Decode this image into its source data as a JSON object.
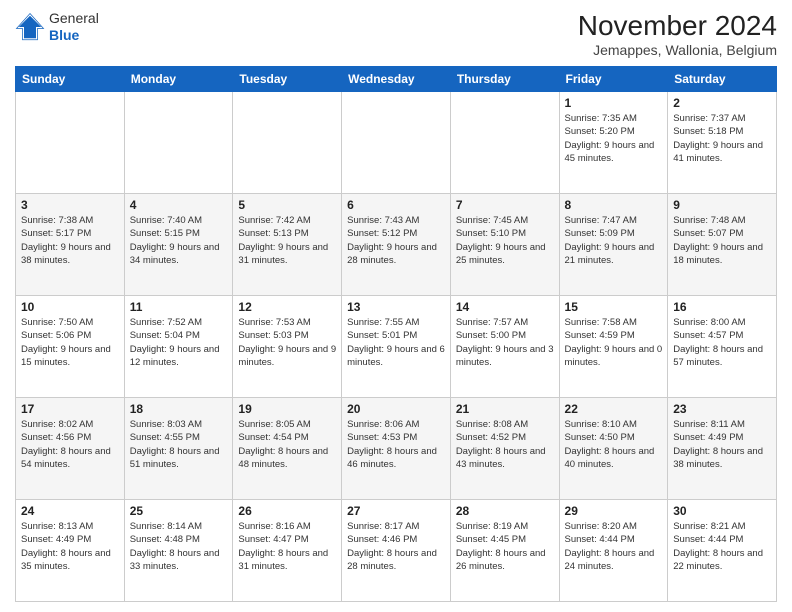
{
  "logo": {
    "general": "General",
    "blue": "Blue"
  },
  "header": {
    "title": "November 2024",
    "subtitle": "Jemappes, Wallonia, Belgium"
  },
  "weekdays": [
    "Sunday",
    "Monday",
    "Tuesday",
    "Wednesday",
    "Thursday",
    "Friday",
    "Saturday"
  ],
  "weeks": [
    [
      {
        "day": "",
        "info": ""
      },
      {
        "day": "",
        "info": ""
      },
      {
        "day": "",
        "info": ""
      },
      {
        "day": "",
        "info": ""
      },
      {
        "day": "",
        "info": ""
      },
      {
        "day": "1",
        "sunrise": "Sunrise: 7:35 AM",
        "sunset": "Sunset: 5:20 PM",
        "daylight": "Daylight: 9 hours and 45 minutes."
      },
      {
        "day": "2",
        "sunrise": "Sunrise: 7:37 AM",
        "sunset": "Sunset: 5:18 PM",
        "daylight": "Daylight: 9 hours and 41 minutes."
      }
    ],
    [
      {
        "day": "3",
        "sunrise": "Sunrise: 7:38 AM",
        "sunset": "Sunset: 5:17 PM",
        "daylight": "Daylight: 9 hours and 38 minutes."
      },
      {
        "day": "4",
        "sunrise": "Sunrise: 7:40 AM",
        "sunset": "Sunset: 5:15 PM",
        "daylight": "Daylight: 9 hours and 34 minutes."
      },
      {
        "day": "5",
        "sunrise": "Sunrise: 7:42 AM",
        "sunset": "Sunset: 5:13 PM",
        "daylight": "Daylight: 9 hours and 31 minutes."
      },
      {
        "day": "6",
        "sunrise": "Sunrise: 7:43 AM",
        "sunset": "Sunset: 5:12 PM",
        "daylight": "Daylight: 9 hours and 28 minutes."
      },
      {
        "day": "7",
        "sunrise": "Sunrise: 7:45 AM",
        "sunset": "Sunset: 5:10 PM",
        "daylight": "Daylight: 9 hours and 25 minutes."
      },
      {
        "day": "8",
        "sunrise": "Sunrise: 7:47 AM",
        "sunset": "Sunset: 5:09 PM",
        "daylight": "Daylight: 9 hours and 21 minutes."
      },
      {
        "day": "9",
        "sunrise": "Sunrise: 7:48 AM",
        "sunset": "Sunset: 5:07 PM",
        "daylight": "Daylight: 9 hours and 18 minutes."
      }
    ],
    [
      {
        "day": "10",
        "sunrise": "Sunrise: 7:50 AM",
        "sunset": "Sunset: 5:06 PM",
        "daylight": "Daylight: 9 hours and 15 minutes."
      },
      {
        "day": "11",
        "sunrise": "Sunrise: 7:52 AM",
        "sunset": "Sunset: 5:04 PM",
        "daylight": "Daylight: 9 hours and 12 minutes."
      },
      {
        "day": "12",
        "sunrise": "Sunrise: 7:53 AM",
        "sunset": "Sunset: 5:03 PM",
        "daylight": "Daylight: 9 hours and 9 minutes."
      },
      {
        "day": "13",
        "sunrise": "Sunrise: 7:55 AM",
        "sunset": "Sunset: 5:01 PM",
        "daylight": "Daylight: 9 hours and 6 minutes."
      },
      {
        "day": "14",
        "sunrise": "Sunrise: 7:57 AM",
        "sunset": "Sunset: 5:00 PM",
        "daylight": "Daylight: 9 hours and 3 minutes."
      },
      {
        "day": "15",
        "sunrise": "Sunrise: 7:58 AM",
        "sunset": "Sunset: 4:59 PM",
        "daylight": "Daylight: 9 hours and 0 minutes."
      },
      {
        "day": "16",
        "sunrise": "Sunrise: 8:00 AM",
        "sunset": "Sunset: 4:57 PM",
        "daylight": "Daylight: 8 hours and 57 minutes."
      }
    ],
    [
      {
        "day": "17",
        "sunrise": "Sunrise: 8:02 AM",
        "sunset": "Sunset: 4:56 PM",
        "daylight": "Daylight: 8 hours and 54 minutes."
      },
      {
        "day": "18",
        "sunrise": "Sunrise: 8:03 AM",
        "sunset": "Sunset: 4:55 PM",
        "daylight": "Daylight: 8 hours and 51 minutes."
      },
      {
        "day": "19",
        "sunrise": "Sunrise: 8:05 AM",
        "sunset": "Sunset: 4:54 PM",
        "daylight": "Daylight: 8 hours and 48 minutes."
      },
      {
        "day": "20",
        "sunrise": "Sunrise: 8:06 AM",
        "sunset": "Sunset: 4:53 PM",
        "daylight": "Daylight: 8 hours and 46 minutes."
      },
      {
        "day": "21",
        "sunrise": "Sunrise: 8:08 AM",
        "sunset": "Sunset: 4:52 PM",
        "daylight": "Daylight: 8 hours and 43 minutes."
      },
      {
        "day": "22",
        "sunrise": "Sunrise: 8:10 AM",
        "sunset": "Sunset: 4:50 PM",
        "daylight": "Daylight: 8 hours and 40 minutes."
      },
      {
        "day": "23",
        "sunrise": "Sunrise: 8:11 AM",
        "sunset": "Sunset: 4:49 PM",
        "daylight": "Daylight: 8 hours and 38 minutes."
      }
    ],
    [
      {
        "day": "24",
        "sunrise": "Sunrise: 8:13 AM",
        "sunset": "Sunset: 4:49 PM",
        "daylight": "Daylight: 8 hours and 35 minutes."
      },
      {
        "day": "25",
        "sunrise": "Sunrise: 8:14 AM",
        "sunset": "Sunset: 4:48 PM",
        "daylight": "Daylight: 8 hours and 33 minutes."
      },
      {
        "day": "26",
        "sunrise": "Sunrise: 8:16 AM",
        "sunset": "Sunset: 4:47 PM",
        "daylight": "Daylight: 8 hours and 31 minutes."
      },
      {
        "day": "27",
        "sunrise": "Sunrise: 8:17 AM",
        "sunset": "Sunset: 4:46 PM",
        "daylight": "Daylight: 8 hours and 28 minutes."
      },
      {
        "day": "28",
        "sunrise": "Sunrise: 8:19 AM",
        "sunset": "Sunset: 4:45 PM",
        "daylight": "Daylight: 8 hours and 26 minutes."
      },
      {
        "day": "29",
        "sunrise": "Sunrise: 8:20 AM",
        "sunset": "Sunset: 4:44 PM",
        "daylight": "Daylight: 8 hours and 24 minutes."
      },
      {
        "day": "30",
        "sunrise": "Sunrise: 8:21 AM",
        "sunset": "Sunset: 4:44 PM",
        "daylight": "Daylight: 8 hours and 22 minutes."
      }
    ]
  ]
}
